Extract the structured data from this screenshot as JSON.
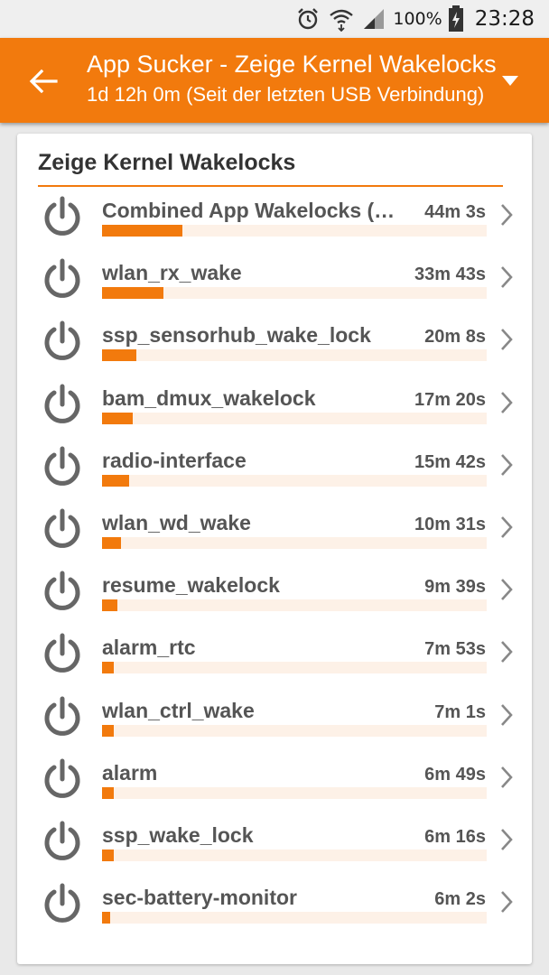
{
  "status_bar": {
    "battery_percent": "100%",
    "time": "23:28",
    "icons": [
      "alarm-icon",
      "wifi-icon",
      "signal-icon",
      "battery-charging-icon"
    ]
  },
  "app_bar": {
    "title": "App Sucker - Zeige Kernel Wakelocks",
    "subtitle": "1d 12h 0m (Seit der letzten USB Verbindung)",
    "accent_color": "#f27a0d"
  },
  "card": {
    "title": "Zeige Kernel Wakelocks"
  },
  "wakelocks": [
    {
      "name": "Combined App Wakelocks (Summe)",
      "time": "44m 3s",
      "fraction": 0.21
    },
    {
      "name": "wlan_rx_wake",
      "time": "33m 43s",
      "fraction": 0.16
    },
    {
      "name": "ssp_sensorhub_wake_lock",
      "time": "20m 8s",
      "fraction": 0.09
    },
    {
      "name": "bam_dmux_wakelock",
      "time": "17m 20s",
      "fraction": 0.08
    },
    {
      "name": "radio-interface",
      "time": "15m 42s",
      "fraction": 0.07
    },
    {
      "name": "wlan_wd_wake",
      "time": "10m 31s",
      "fraction": 0.05
    },
    {
      "name": "resume_wakelock",
      "time": "9m 39s",
      "fraction": 0.04
    },
    {
      "name": "alarm_rtc",
      "time": "7m 53s",
      "fraction": 0.03
    },
    {
      "name": "wlan_ctrl_wake",
      "time": "7m 1s",
      "fraction": 0.03
    },
    {
      "name": "alarm",
      "time": "6m 49s",
      "fraction": 0.03
    },
    {
      "name": "ssp_wake_lock",
      "time": "6m 16s",
      "fraction": 0.03
    },
    {
      "name": "sec-battery-monitor",
      "time": "6m 2s",
      "fraction": 0.02
    }
  ]
}
